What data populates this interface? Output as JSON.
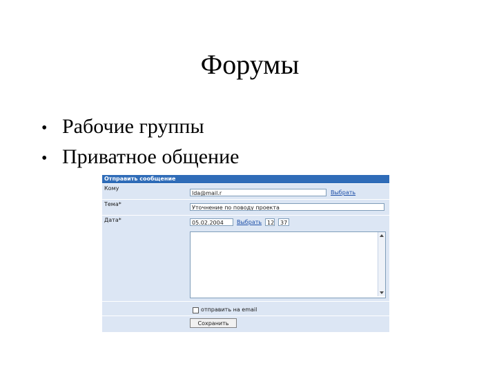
{
  "slide": {
    "title": "Форумы",
    "bullets": [
      "Рабочие группы",
      "Приватное общение"
    ]
  },
  "form": {
    "header": "Отправить сообщение",
    "to_label": "Кому",
    "to_value": "lda@mail.r",
    "to_link": "Выбрать",
    "subject_label": "Тема*",
    "subject_value": "Уточнение по поводу проекта",
    "date_label": "Дата*",
    "date_value": "05.02.2004",
    "date_link": "Выбрать",
    "hour_value": "12",
    "minute_value": "37",
    "email_checkbox_label": "отправить на email",
    "save_button": "Сохранить"
  }
}
